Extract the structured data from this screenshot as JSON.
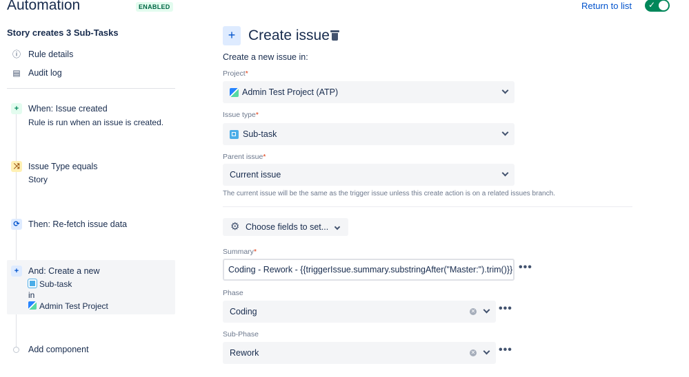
{
  "header": {
    "title": "Automation",
    "status_badge": "ENABLED",
    "return_link": "Return to list",
    "toggle_checked_glyph": "✓"
  },
  "sidebar": {
    "rule_name": "Story creates 3 Sub-Tasks",
    "links": [
      {
        "label": "Rule details",
        "icon": "info-icon"
      },
      {
        "label": "Audit log",
        "icon": "audit-log-icon"
      }
    ],
    "steps": [
      {
        "title": "When: Issue created",
        "description": "Rule is run when an issue is created.",
        "icon": "trigger-plus-icon",
        "color": "#00875a"
      },
      {
        "title": "Issue Type equals",
        "description": "Story",
        "icon": "condition-shuffle-icon",
        "color": "#974f0c"
      },
      {
        "title": "Then: Re-fetch issue data",
        "icon": "refresh-icon",
        "color": "#0052cc"
      },
      {
        "title": "And: Create a new",
        "line2": "Sub-task",
        "line3": "in",
        "line4": "Admin Test Project",
        "icon": "action-plus-icon",
        "color": "#0052cc"
      }
    ],
    "add_component": "Add component"
  },
  "form": {
    "add_icon_glyph": "+",
    "title": "Create issue",
    "subtitle": "Create a new issue in:",
    "project": {
      "label": "Project",
      "value": "Admin Test Project (ATP)"
    },
    "issue_type": {
      "label": "Issue type",
      "value": "Sub-task"
    },
    "parent_issue": {
      "label": "Parent issue",
      "value": "Current issue"
    },
    "helper_text": "The current issue will be the same as the trigger issue unless this create action is on a related issues branch.",
    "choose_fields": "Choose fields to set...",
    "summary": {
      "label": "Summary",
      "value": "Coding - Rework - {{triggerIssue.summary.substringAfter(\"Master:\").trim()}}"
    },
    "phase": {
      "label": "Phase",
      "value": "Coding"
    },
    "sub_phase": {
      "label": "Sub-Phase",
      "value": "Rework"
    },
    "required_marker": "*",
    "more_glyph": "•••"
  },
  "colors": {
    "accent": "#0052cc",
    "toggle_on": "#00875a",
    "required": "#de350b"
  }
}
